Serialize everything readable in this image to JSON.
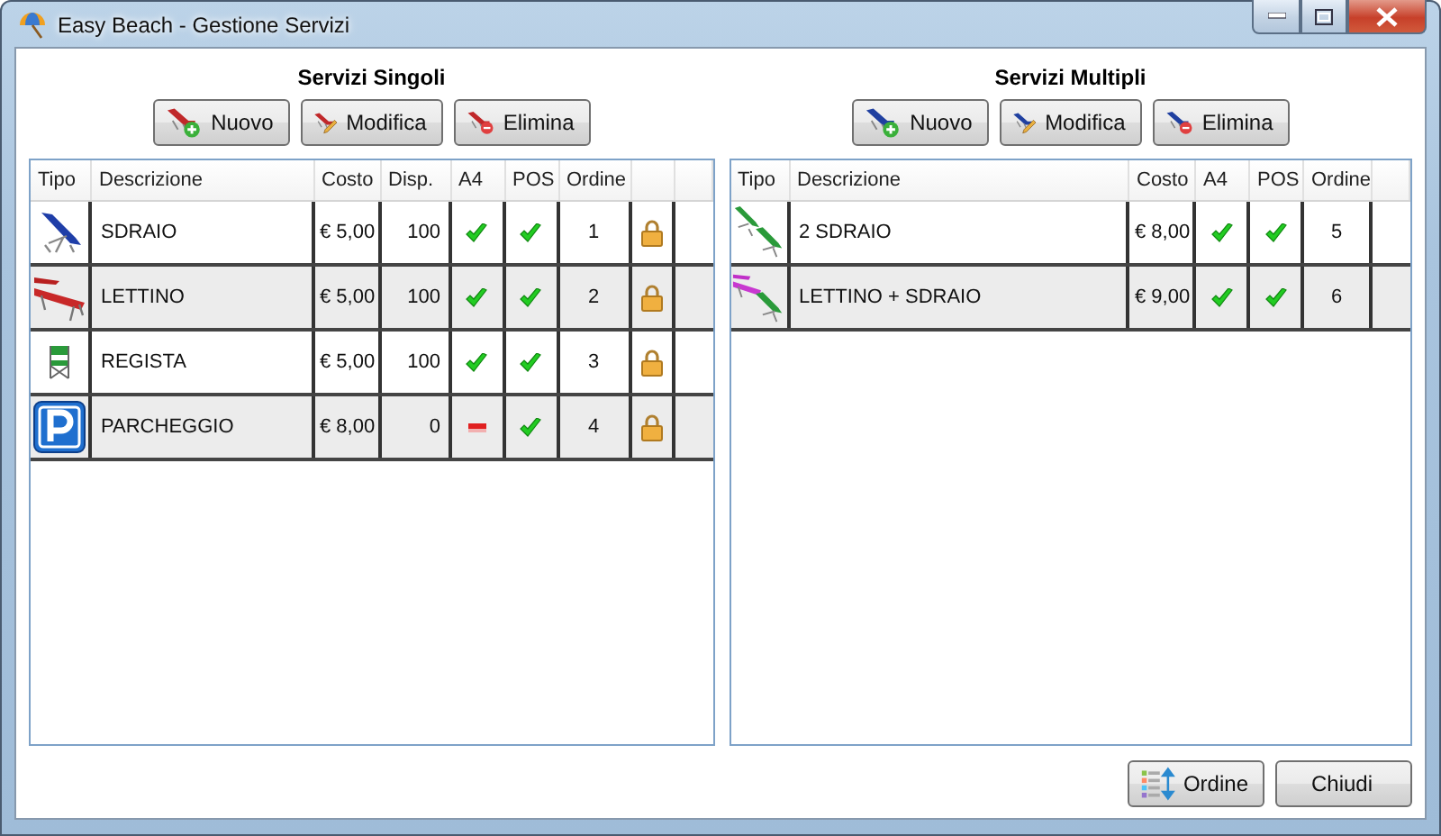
{
  "window": {
    "title": "Easy Beach - Gestione Servizi"
  },
  "panels": [
    {
      "kind": "single",
      "title": "Servizi Singoli",
      "buttons": [
        {
          "kind": "add",
          "label": "Nuovo"
        },
        {
          "kind": "edit",
          "label": "Modifica"
        },
        {
          "kind": "delete",
          "label": "Elimina"
        }
      ],
      "columns": [
        "Tipo",
        "Descrizione",
        "Costo",
        "Disp.",
        "A4",
        "POS",
        "Ordine"
      ],
      "rows": [
        {
          "kind": "sdraio",
          "descrizione": "SDRAIO",
          "costo": "€ 5,00",
          "disp": "100",
          "a4": true,
          "pos": true,
          "ordine": "1",
          "locked": true
        },
        {
          "kind": "lettino",
          "descrizione": "LETTINO",
          "costo": "€ 5,00",
          "disp": "100",
          "a4": true,
          "pos": true,
          "ordine": "2",
          "locked": true
        },
        {
          "kind": "regista",
          "descrizione": "REGISTA",
          "costo": "€ 5,00",
          "disp": "100",
          "a4": true,
          "pos": true,
          "ordine": "3",
          "locked": true
        },
        {
          "kind": "parcheggio",
          "descrizione": "PARCHEGGIO",
          "costo": "€ 8,00",
          "disp": "0",
          "a4": false,
          "pos": true,
          "ordine": "4",
          "locked": true
        }
      ]
    },
    {
      "kind": "multiple",
      "title": "Servizi Multipli",
      "buttons": [
        {
          "kind": "add",
          "label": "Nuovo"
        },
        {
          "kind": "edit",
          "label": "Modifica"
        },
        {
          "kind": "delete",
          "label": "Elimina"
        }
      ],
      "columns": [
        "Tipo",
        "Descrizione",
        "Costo",
        "A4",
        "POS",
        "Ordine"
      ],
      "rows": [
        {
          "kind": "due-sdraio",
          "descrizione": "2 SDRAIO",
          "costo": "€ 8,00",
          "a4": true,
          "pos": true,
          "ordine": "5"
        },
        {
          "kind": "lettino-sdraio",
          "descrizione": "LETTINO + SDRAIO",
          "costo": "€ 9,00",
          "a4": true,
          "pos": true,
          "ordine": "6"
        }
      ]
    }
  ],
  "footer_buttons": [
    {
      "kind": "order",
      "label": "Ordine"
    },
    {
      "kind": "close",
      "label": "Chiudi"
    }
  ]
}
